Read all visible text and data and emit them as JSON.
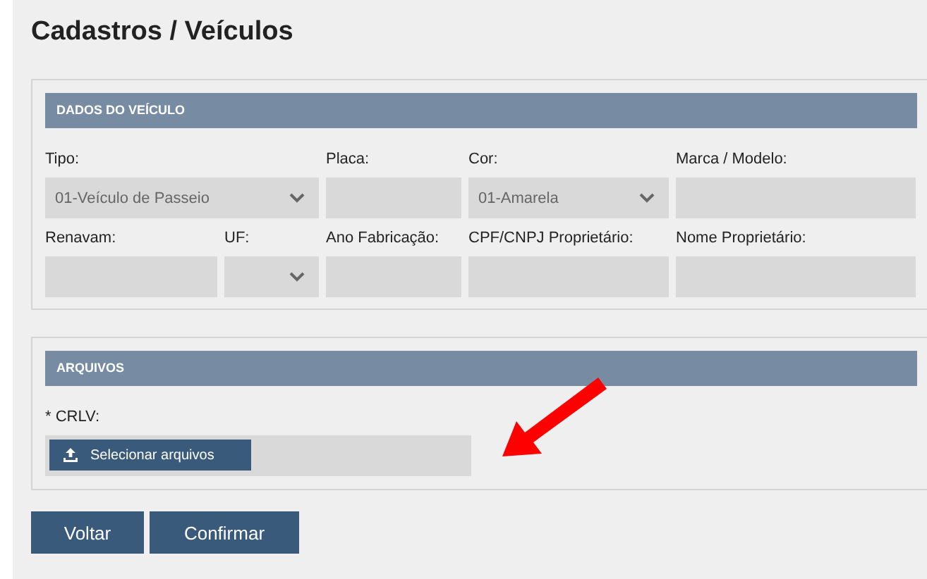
{
  "title": "Cadastros / Veículos",
  "sections": [
    {
      "heading": "DADOS DO VEÍCULO",
      "fields": [
        {
          "label": "Tipo:",
          "kind": "select",
          "value": "01-Veículo de Passeio"
        },
        {
          "label": "Placa:",
          "kind": "text"
        },
        {
          "label": "Cor:",
          "kind": "select",
          "value": "01-Amarela"
        },
        {
          "label": "Marca / Modelo:",
          "kind": "text"
        },
        {
          "label": "Renavam:",
          "kind": "text"
        },
        {
          "label": "UF:",
          "kind": "select"
        },
        {
          "label": "Ano Fabricação:",
          "kind": "text"
        },
        {
          "label": "CPF/CNPJ Proprietário:",
          "kind": "text"
        },
        {
          "label": "Nome Proprietário:",
          "kind": "text"
        }
      ]
    },
    {
      "heading": "ARQUIVOS",
      "fields": [
        {
          "label": "* CRLV:",
          "kind": "file",
          "button": "Selecionar arquivos"
        }
      ]
    }
  ],
  "buttons": [
    "Voltar",
    "Confirmar"
  ]
}
